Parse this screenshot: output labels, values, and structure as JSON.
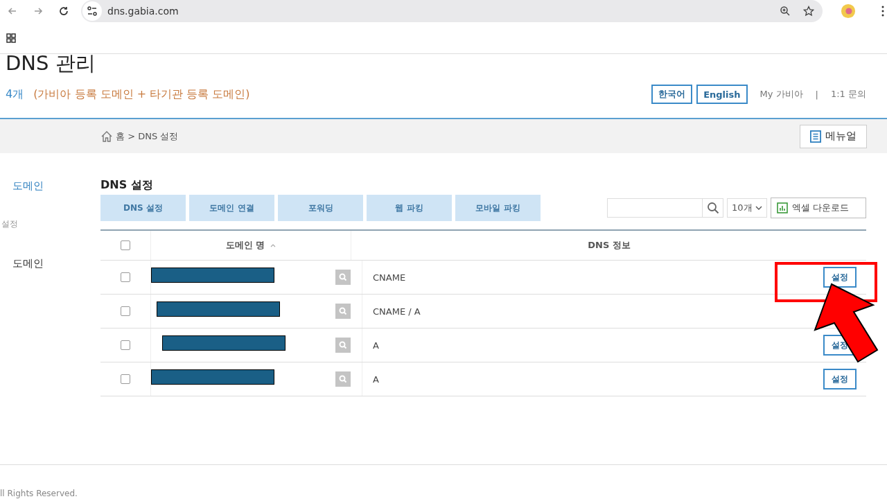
{
  "browser": {
    "url": "dns.gabia.com"
  },
  "header": {
    "title": "DNS 관리",
    "count": "4개",
    "count_note": "(가비아 등록 도메인 + 타기관 등록 도메인)",
    "languages": [
      {
        "label": "한국어"
      },
      {
        "label": "English"
      }
    ],
    "links": [
      "My 가비아",
      "|",
      "1:1 문의"
    ]
  },
  "breadcrumb": {
    "home": "홈 > DNS 설정"
  },
  "manual_button": "메뉴얼",
  "sidebar": {
    "items": [
      {
        "label": "도메인",
        "kind": "group",
        "selected": true
      },
      {
        "label": "설정",
        "kind": "sub",
        "selected": false
      },
      {
        "label": "도메인",
        "kind": "group",
        "selected": false
      }
    ]
  },
  "section_title": "DNS 설정",
  "tabs": [
    {
      "label": "DNS 설정",
      "disabled": true
    },
    {
      "label": "도메인 연결",
      "disabled": true
    },
    {
      "label": "포워딩",
      "disabled": true
    },
    {
      "label": "웹 파킹",
      "disabled": true
    },
    {
      "label": "모바일 파킹",
      "disabled": true
    }
  ],
  "page_size": "10개",
  "excel_button": "엑셀 다운로드",
  "table": {
    "checked": false,
    "columns": [
      "도메인 명",
      "DNS 정보"
    ],
    "rows": [
      {
        "checked": false,
        "dns": "CNAME",
        "action": "설정"
      },
      {
        "checked": false,
        "dns": "CNAME / A"
      },
      {
        "checked": false,
        "dns": "A",
        "action": "설정"
      },
      {
        "checked": false,
        "dns": "A",
        "action": "설정"
      }
    ]
  },
  "footer": "ll Rights Reserved."
}
